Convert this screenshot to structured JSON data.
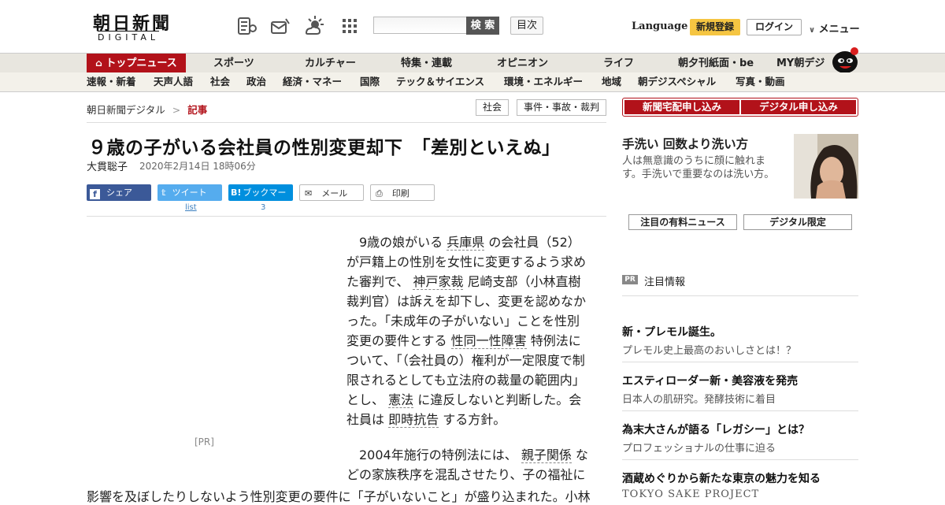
{
  "header": {
    "logo_main": "朝日新聞",
    "logo_sub": "DIGITAL",
    "search_placeholder": "",
    "search_button": "検 索",
    "toc_button": "目次",
    "language": "Language",
    "register": "新規登録",
    "login": "ログイン",
    "menu": "メニュー"
  },
  "nav_primary": [
    {
      "label": "トップニュース"
    },
    {
      "label": "スポーツ"
    },
    {
      "label": "カルチャー"
    },
    {
      "label": "特集・連載"
    },
    {
      "label": "オピニオン"
    },
    {
      "label": "ライフ"
    },
    {
      "label": "朝夕刊紙面・be"
    },
    {
      "label": "MY朝デジ"
    }
  ],
  "nav_secondary": [
    {
      "label": "速報・新着"
    },
    {
      "label": "天声人語"
    },
    {
      "label": "社会"
    },
    {
      "label": "政治"
    },
    {
      "label": "経済・マネー"
    },
    {
      "label": "国際"
    },
    {
      "label": "テック＆サイエンス"
    },
    {
      "label": "環境・エネルギー"
    },
    {
      "label": "地域"
    },
    {
      "label": "朝デジスペシャル"
    },
    {
      "label": "写真・動画"
    }
  ],
  "breadcrumb": {
    "root": "朝日新聞デジタル",
    "sep": ">",
    "current": "記事"
  },
  "tags": [
    "社会",
    "事件・事故・裁判"
  ],
  "article": {
    "headline": "９歳の子がいる会社員の性別変更却下　「差別といえぬ」",
    "author": "大貫聡子",
    "date": "2020年2月14日 18時06分",
    "pr_label": "[PR]",
    "p1": {
      "t1": "9歳の娘がいる ",
      "l1": "兵庫県",
      "t2": " の会社員（52）が戸籍上の性別を女性に変更するよう求めた審判で、 ",
      "l2": "神戸家裁",
      "t3": " 尼崎支部（小林直樹裁判官）は訴えを却下し、変更を認めなかった。「未成年の子がいない」ことを性別変更の要件とする ",
      "l3": "性同一性障害",
      "t4": " 特例法について、「（会社員の）権利が一定限度で制限されるとしても立法府の裁量の範囲内」とし、 ",
      "l4": "憲法",
      "t5": " に違反しないと判断した。会社員は ",
      "l5": "即時抗告",
      "t6": " する方針。"
    },
    "p2": {
      "t1": "2004年施行の特例法には、 ",
      "l1": "親子関係",
      "t2": " などの家族秩序を混乱させたり、子の福祉に"
    },
    "overflow_line": "影響を及ぼしたりしないよう性別変更の要件に「子がいないこと」が盛り込まれた。小林"
  },
  "share": {
    "facebook": "シェア",
    "twitter": "ツイート",
    "twitter_count": "list",
    "hatena": "ブックマーク",
    "hatena_count": "3",
    "mail": "メール",
    "print": "印刷"
  },
  "sidebar": {
    "subscribe_home": "新聞宅配申し込み",
    "subscribe_digital": "デジタル申し込み",
    "feature_title": "手洗い 回数より洗い方",
    "feature_desc": "人は無意識のうちに顔に触れます。手洗いで重要なのは洗い方。",
    "tab_paid": "注目の有料ニュース",
    "tab_digital": "デジタル限定",
    "pr_badge": "PR",
    "pr_heading": "注目情報",
    "ads": [
      {
        "title": "新・プレモル誕生。",
        "desc": "プレモル史上最高のおいしさとは！？"
      },
      {
        "title": "エスティローダー新・美容液を発売",
        "desc": "日本人の肌研究。発酵技術に着目"
      },
      {
        "title": "為末大さんが語る「レガシー」とは？",
        "desc": "プロフェッショナルの仕事に迫る"
      },
      {
        "title": "酒蔵めぐりから新たな東京の魅力を知る",
        "desc": "TOKYO SAKE PROJECT"
      }
    ]
  },
  "colors": {
    "brand_red": "#b2121a",
    "register_yellow": "#f5c542",
    "facebook": "#3b5998",
    "twitter": "#55acee",
    "hatena": "#008fde"
  }
}
